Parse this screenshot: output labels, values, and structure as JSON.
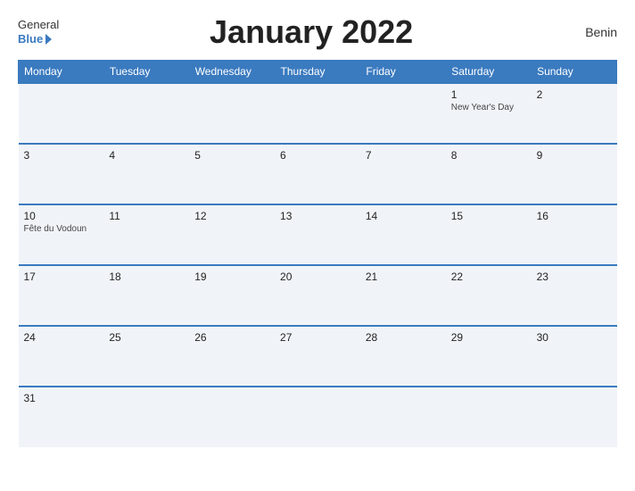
{
  "header": {
    "logo_general": "General",
    "logo_blue": "Blue",
    "title": "January 2022",
    "country": "Benin"
  },
  "weekdays": [
    "Monday",
    "Tuesday",
    "Wednesday",
    "Thursday",
    "Friday",
    "Saturday",
    "Sunday"
  ],
  "weeks": [
    {
      "days": [
        {
          "number": "",
          "holiday": ""
        },
        {
          "number": "",
          "holiday": ""
        },
        {
          "number": "",
          "holiday": ""
        },
        {
          "number": "",
          "holiday": ""
        },
        {
          "number": "",
          "holiday": ""
        },
        {
          "number": "1",
          "holiday": "New Year's Day"
        },
        {
          "number": "2",
          "holiday": ""
        }
      ]
    },
    {
      "days": [
        {
          "number": "3",
          "holiday": ""
        },
        {
          "number": "4",
          "holiday": ""
        },
        {
          "number": "5",
          "holiday": ""
        },
        {
          "number": "6",
          "holiday": ""
        },
        {
          "number": "7",
          "holiday": ""
        },
        {
          "number": "8",
          "holiday": ""
        },
        {
          "number": "9",
          "holiday": ""
        }
      ]
    },
    {
      "days": [
        {
          "number": "10",
          "holiday": "Fête du Vodoun"
        },
        {
          "number": "11",
          "holiday": ""
        },
        {
          "number": "12",
          "holiday": ""
        },
        {
          "number": "13",
          "holiday": ""
        },
        {
          "number": "14",
          "holiday": ""
        },
        {
          "number": "15",
          "holiday": ""
        },
        {
          "number": "16",
          "holiday": ""
        }
      ]
    },
    {
      "days": [
        {
          "number": "17",
          "holiday": ""
        },
        {
          "number": "18",
          "holiday": ""
        },
        {
          "number": "19",
          "holiday": ""
        },
        {
          "number": "20",
          "holiday": ""
        },
        {
          "number": "21",
          "holiday": ""
        },
        {
          "number": "22",
          "holiday": ""
        },
        {
          "number": "23",
          "holiday": ""
        }
      ]
    },
    {
      "days": [
        {
          "number": "24",
          "holiday": ""
        },
        {
          "number": "25",
          "holiday": ""
        },
        {
          "number": "26",
          "holiday": ""
        },
        {
          "number": "27",
          "holiday": ""
        },
        {
          "number": "28",
          "holiday": ""
        },
        {
          "number": "29",
          "holiday": ""
        },
        {
          "number": "30",
          "holiday": ""
        }
      ]
    },
    {
      "days": [
        {
          "number": "31",
          "holiday": ""
        },
        {
          "number": "",
          "holiday": ""
        },
        {
          "number": "",
          "holiday": ""
        },
        {
          "number": "",
          "holiday": ""
        },
        {
          "number": "",
          "holiday": ""
        },
        {
          "number": "",
          "holiday": ""
        },
        {
          "number": "",
          "holiday": ""
        }
      ]
    }
  ]
}
